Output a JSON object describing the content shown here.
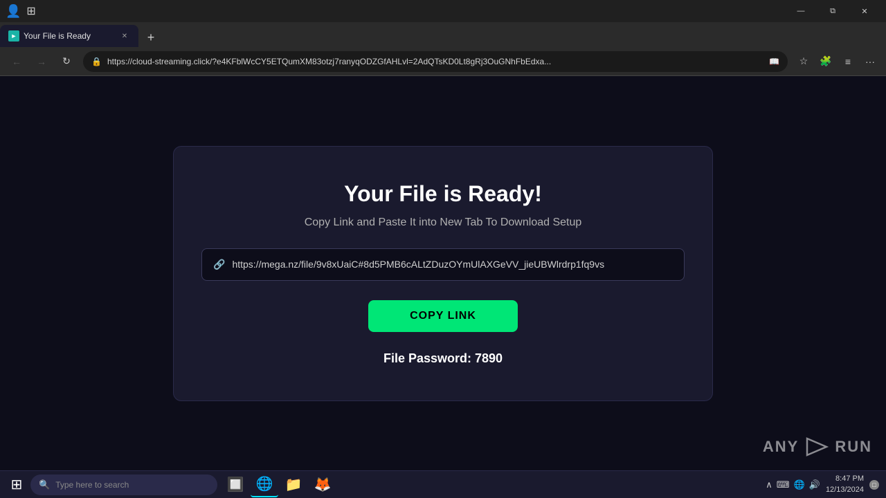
{
  "browser": {
    "titlebar": {
      "profile_icon": "👤",
      "tab_icon": "⊞",
      "minimize": "—",
      "restore": "⧉",
      "close": "✕"
    },
    "tab": {
      "favicon_text": "►",
      "title": "Your File is Ready",
      "close": "✕"
    },
    "newtab": "+",
    "navbar": {
      "back": "←",
      "forward": "→",
      "refresh": "↻",
      "url": "https://cloud-streaming.click/?e4KFblWcCY5ETQumXM83otzj7ranyqODZGfAHLvl=2AdQTsKD0Lt8gRj3OuGNhFbEdxa...",
      "security_icon": "🔒",
      "read_icon": "📖",
      "bookmark": "☆",
      "extensions": "🧩",
      "collections": "≡",
      "settings": "···"
    }
  },
  "page": {
    "title": "Your File is Ready!",
    "subtitle": "Copy Link and Paste It into New Tab To Download Setup",
    "link": "https://mega.nz/file/9v8xUaiC#8d5PMB6cALtZDuzOYmUlAXGeVV_jieUBWlrdrp1fq9vs",
    "copy_button": "COPY LINK",
    "password_label": "File Password: 7890"
  },
  "watermark": {
    "text": "ANY.RUN",
    "play_icon": "▶"
  },
  "taskbar": {
    "start_icon": "⊞",
    "search_placeholder": "Type here to search",
    "apps": [
      {
        "icon": "🔲",
        "name": "task-view"
      },
      {
        "icon": "🌐",
        "name": "edge-browser",
        "active": true
      },
      {
        "icon": "📁",
        "name": "file-explorer"
      },
      {
        "icon": "🦊",
        "name": "firefox"
      }
    ],
    "system": {
      "show_hidden": "∧",
      "keyboard": "⌨",
      "network": "🌐",
      "volume": "🔊",
      "time": "8:47 PM",
      "date": "12/13/2024",
      "notification": "□"
    }
  }
}
